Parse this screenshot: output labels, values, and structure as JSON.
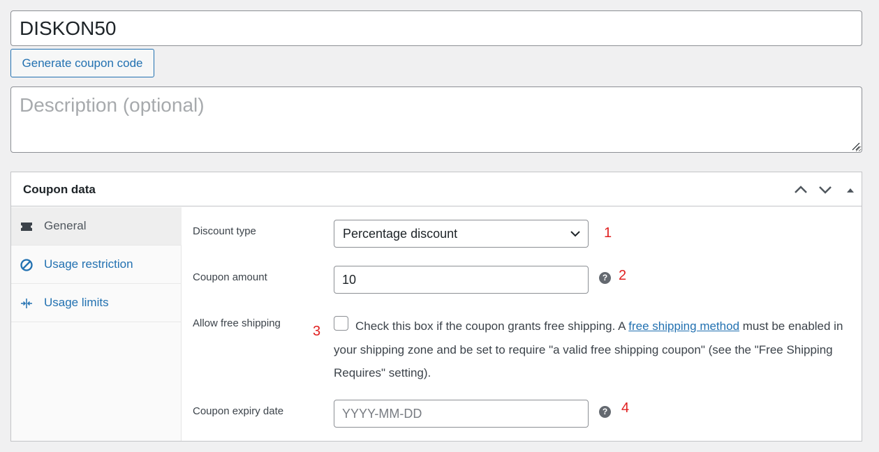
{
  "coupon": {
    "code": "DISKON50",
    "generate_label": "Generate coupon code",
    "description_placeholder": "Description (optional)"
  },
  "panel": {
    "title": "Coupon data",
    "controls": [
      "move-up-icon",
      "move-down-icon",
      "collapse-icon"
    ]
  },
  "tabs": [
    {
      "label": "General",
      "icon": "ticket-icon",
      "active": true
    },
    {
      "label": "Usage restriction",
      "icon": "block-icon",
      "active": false
    },
    {
      "label": "Usage limits",
      "icon": "arrows-in-icon",
      "active": false
    }
  ],
  "fields": {
    "discount_type": {
      "label": "Discount type",
      "value": "Percentage discount"
    },
    "coupon_amount": {
      "label": "Coupon amount",
      "value": "10"
    },
    "free_shipping": {
      "label": "Allow free shipping",
      "text_before": "Check this box if the coupon grants free shipping. A ",
      "link": "free shipping method",
      "text_after": " must be enabled in your shipping zone and be set to require \"a valid free shipping coupon\" (see the \"Free Shipping Requires\" setting).",
      "checked": false
    },
    "expiry_date": {
      "label": "Coupon expiry date",
      "placeholder": "YYYY-MM-DD"
    }
  },
  "help_glyph": "?",
  "annotations": [
    "1",
    "2",
    "3",
    "4"
  ],
  "colors": {
    "accent": "#2271b1",
    "annotation": "#e02020",
    "background": "#f0f0f1"
  }
}
